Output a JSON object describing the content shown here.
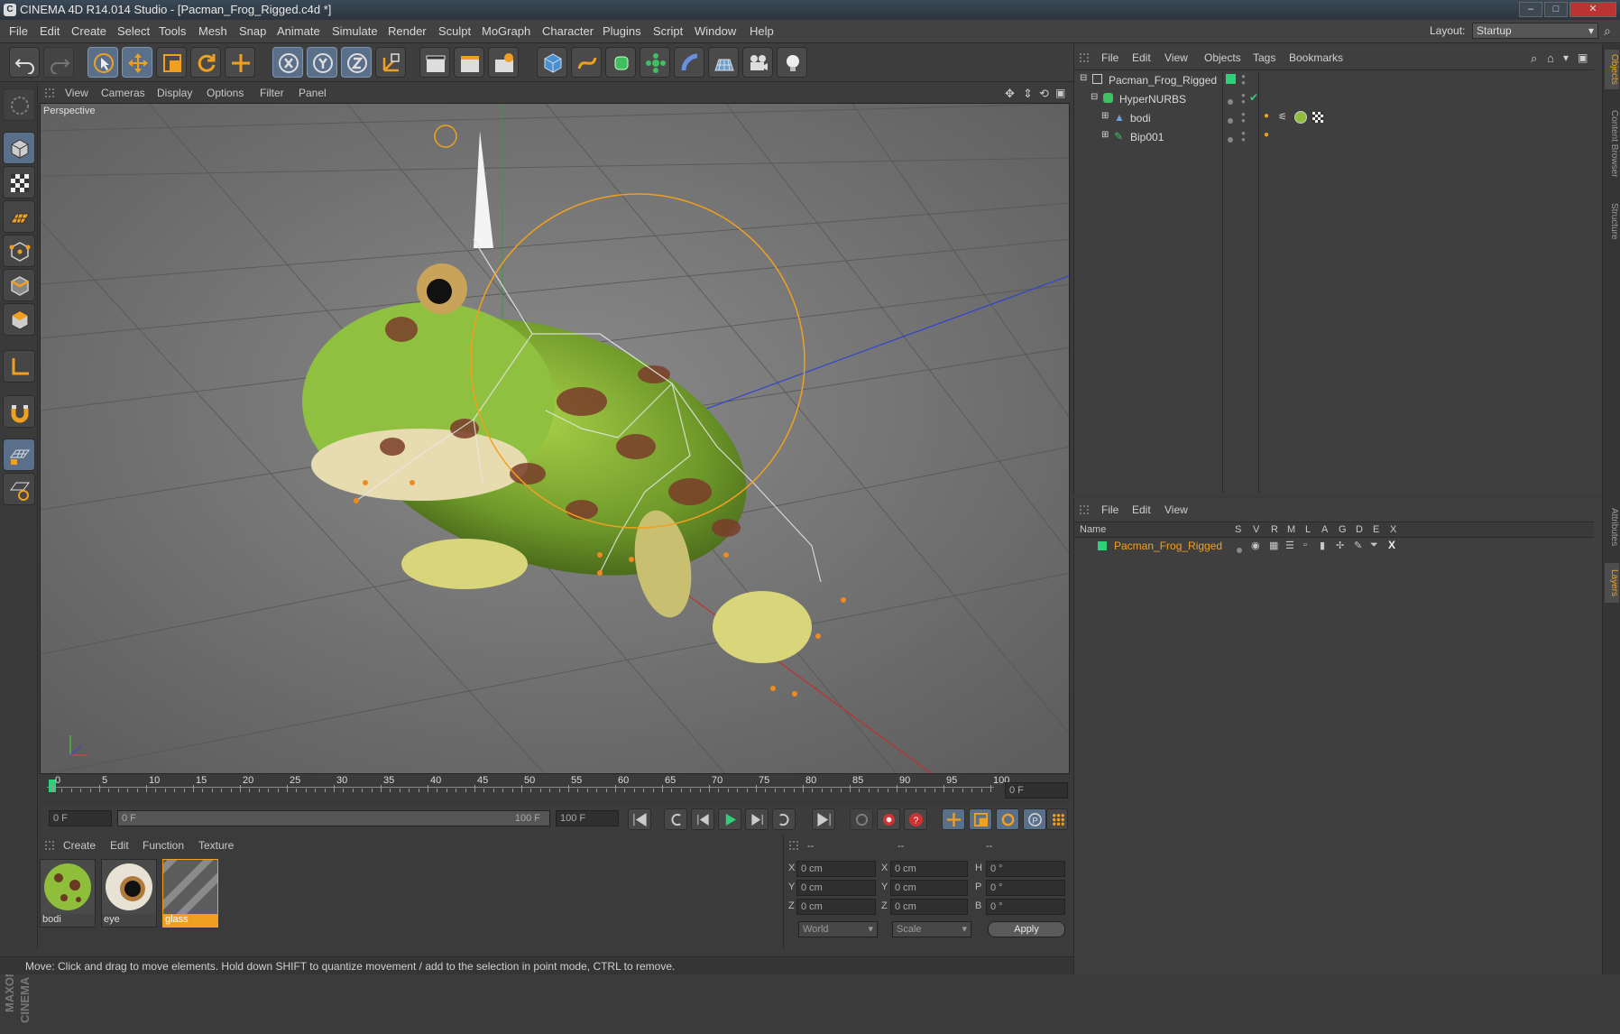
{
  "window": {
    "title": "CINEMA 4D R14.014 Studio - [Pacman_Frog_Rigged.c4d *]",
    "app_icon": "C"
  },
  "menu": [
    "File",
    "Edit",
    "Create",
    "Select",
    "Tools",
    "Mesh",
    "Snap",
    "Animate",
    "Simulate",
    "Render",
    "Sculpt",
    "MoGraph",
    "Character",
    "Plugins",
    "Script",
    "Window",
    "Help"
  ],
  "layout": {
    "label": "Layout:",
    "value": "Startup"
  },
  "viewport": {
    "menu": [
      "View",
      "Cameras",
      "Display",
      "Options",
      "Filter",
      "Panel"
    ],
    "label": "Perspective"
  },
  "timeline": {
    "ticks": [
      "0",
      "5",
      "10",
      "15",
      "20",
      "25",
      "30",
      "35",
      "40",
      "45",
      "50",
      "55",
      "60",
      "65",
      "70",
      "75",
      "80",
      "85",
      "90",
      "95",
      "100"
    ],
    "current_frame": "0 F"
  },
  "transport": {
    "start_frame": "0 F",
    "range_start": "0 F",
    "range_end": "100 F",
    "end_frame": "100 F"
  },
  "material_manager": {
    "menu": [
      "Create",
      "Edit",
      "Function",
      "Texture"
    ],
    "materials": [
      {
        "name": "bodi"
      },
      {
        "name": "eye"
      },
      {
        "name": "glass"
      }
    ]
  },
  "coordinates": {
    "headers": [
      "--",
      "--",
      "--"
    ],
    "rows": [
      {
        "a": "X",
        "av": "0 cm",
        "b": "X",
        "bv": "0 cm",
        "c": "H",
        "cv": "0 °"
      },
      {
        "a": "Y",
        "av": "0 cm",
        "b": "Y",
        "bv": "0 cm",
        "c": "P",
        "cv": "0 °"
      },
      {
        "a": "Z",
        "av": "0 cm",
        "b": "Z",
        "bv": "0 cm",
        "c": "B",
        "cv": "0 °"
      }
    ],
    "world": "World",
    "scale": "Scale",
    "apply": "Apply"
  },
  "object_manager": {
    "menu": [
      "File",
      "Edit",
      "View",
      "Objects",
      "Tags",
      "Bookmarks"
    ],
    "objects": [
      {
        "name": "Pacman_Frog_Rigged",
        "icon": "null-icon"
      },
      {
        "name": "HyperNURBS",
        "icon": "hypernurbs-icon"
      },
      {
        "name": "bodi",
        "icon": "polygon-object-icon"
      },
      {
        "name": "Bip001",
        "icon": "bone-icon"
      }
    ]
  },
  "layer_manager": {
    "menu": [
      "File",
      "Edit",
      "View"
    ],
    "columns": [
      "Name",
      "S",
      "V",
      "R",
      "M",
      "L",
      "A",
      "G",
      "D",
      "E",
      "X"
    ],
    "layers": [
      {
        "name": "Pacman_Frog_Rigged",
        "color": "#2fd07a"
      }
    ]
  },
  "right_tabs": [
    "Objects",
    "Content Browser",
    "Structure",
    "Attributes",
    "Layers"
  ],
  "brand": "MAXON CINEMA 4D",
  "status": "Move: Click and drag to move elements. Hold down SHIFT to quantize movement / add to the selection in point mode, CTRL to remove.",
  "colors": {
    "accent": "#f0a020",
    "selection": "#5a6f8a",
    "layer_green": "#2fd07a"
  }
}
